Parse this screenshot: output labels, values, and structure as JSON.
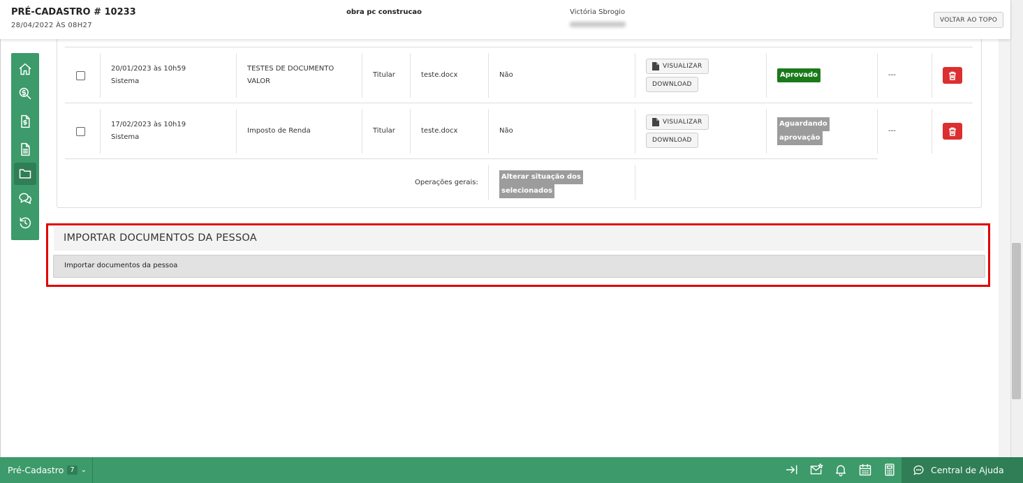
{
  "header": {
    "title": "PRÉ-CADASTRO # 10233",
    "date": "28/04/2022 ÀS 08H27",
    "obra": "obra pc construcao",
    "user": "Victória Sbrogio",
    "back_to_top": "VOLTAR AO TOPO"
  },
  "documents": {
    "rows": [
      {
        "date": "20/01/2023 às 10h59",
        "origin": "Sistema",
        "name_line1": "TESTES DE DOCUMENTO",
        "name_line2": "VALOR",
        "type": "Titular",
        "file": "teste.docx",
        "flag": "Não",
        "view_label": "VISUALIZAR",
        "download_label": "DOWNLOAD",
        "status": "Aprovado",
        "status_color": "#1a7a1a",
        "extra": "---"
      },
      {
        "date": "17/02/2023 às 10h19",
        "origin": "Sistema",
        "name_line1": "Imposto de Renda",
        "type": "Titular",
        "file": "teste.docx",
        "flag": "Não",
        "view_label": "VISUALIZAR",
        "download_label": "DOWNLOAD",
        "status_line1": "Aguardando",
        "status_line2": "aprovação",
        "status_color": "#9c9c9c",
        "extra": "---"
      }
    ],
    "operations_label": "Operações gerais:",
    "operations_button_line1": "Alterar situação dos",
    "operations_button_line2": "selecionados"
  },
  "import_section": {
    "title": "IMPORTAR DOCUMENTOS DA PESSOA",
    "bar_label": "Importar documentos da pessoa"
  },
  "bottombar": {
    "module": "Pré-Cadastro",
    "count": "7",
    "help": "Central de Ajuda"
  },
  "colors": {
    "brand_green": "#3d9a6a",
    "brand_green_dark": "#2f7e55",
    "danger": "#dc2f2f",
    "highlight": "#e00000"
  },
  "icons": {
    "sidebar": [
      "home-icon",
      "search-dollar-icon",
      "invoice-icon",
      "document-icon",
      "folder-icon",
      "chat-icon",
      "history-icon"
    ],
    "bottombar": [
      "collapse-right-icon",
      "envelope-star-icon",
      "bell-icon",
      "calendar-icon",
      "calculator-icon"
    ]
  }
}
